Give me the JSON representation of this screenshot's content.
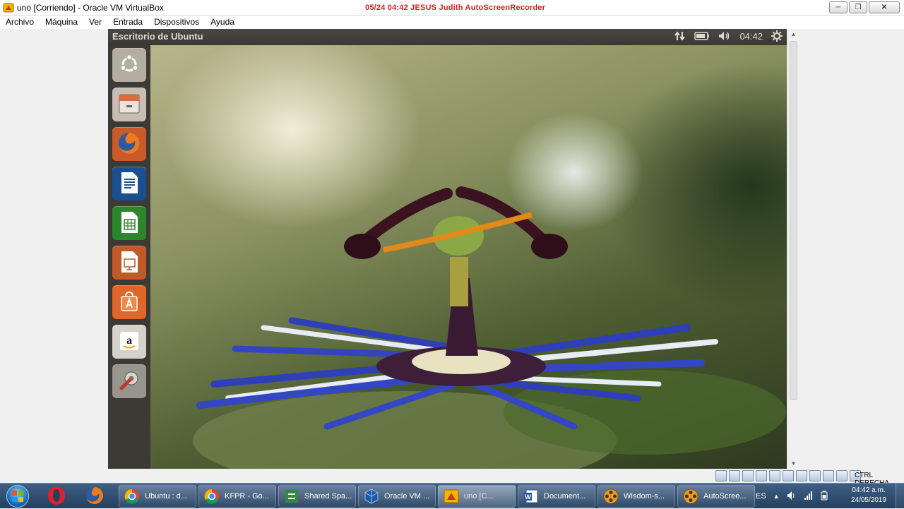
{
  "window": {
    "title": "uno [Corriendo] - Oracle VM VirtualBox",
    "recorder_overlay": "05/24  04:42  JESUS  Judith  AutoScreenRecorder",
    "icon": "virtualbox-window-icon"
  },
  "menubar": {
    "items": [
      "Archivo",
      "Máquina",
      "Ver",
      "Entrada",
      "Dispositivos",
      "Ayuda"
    ]
  },
  "guest": {
    "top_panel": {
      "title": "Escritorio de Ubuntu",
      "clock": "04:42",
      "indicators": [
        "network-arrows-icon",
        "battery-icon",
        "volume-icon",
        "session-gear-icon"
      ]
    },
    "launcher": [
      {
        "name": "ubuntu-dash",
        "icon": "ubuntu-logo-icon",
        "color": "#b8b2a8"
      },
      {
        "name": "files",
        "icon": "file-cabinet-icon",
        "color": "#c9c3b8"
      },
      {
        "name": "firefox",
        "icon": "firefox-icon",
        "color": "#e0632a"
      },
      {
        "name": "libreoffice-writer",
        "icon": "writer-icon",
        "color": "#1f4f8c"
      },
      {
        "name": "libreoffice-calc",
        "icon": "calc-icon",
        "color": "#2e8a2e"
      },
      {
        "name": "libreoffice-impress",
        "icon": "impress-icon",
        "color": "#c85a25"
      },
      {
        "name": "ubuntu-software-center",
        "icon": "software-center-icon",
        "color": "#e86a2a"
      },
      {
        "name": "amazon",
        "icon": "amazon-icon",
        "color": "#d8d4cc"
      },
      {
        "name": "system-settings",
        "icon": "settings-wrench-icon",
        "color": "#9a9890"
      }
    ]
  },
  "statusbar": {
    "host_key": "CTRL DERECHA"
  },
  "taskbar": {
    "pinned": [
      "opera-icon",
      "firefox-icon"
    ],
    "buttons": [
      {
        "label": "Ubuntu : d...",
        "icon": "chrome-icon"
      },
      {
        "label": "KFPR - Go...",
        "icon": "chrome-icon"
      },
      {
        "label": "Shared Spa...",
        "icon": "shared-space-icon"
      },
      {
        "label": "Oracle VM ...",
        "icon": "virtualbox-icon"
      },
      {
        "label": "uno [C...",
        "icon": "virtualbox-vm-icon",
        "active": true
      },
      {
        "label": "Document...",
        "icon": "word-icon"
      },
      {
        "label": "Wisdom-s...",
        "icon": "film-reel-icon"
      },
      {
        "label": "AutoScree...",
        "icon": "film-reel-icon"
      }
    ],
    "tray": {
      "language": "ES",
      "time": "04:42 a.m.",
      "date": "24/05/2019"
    }
  }
}
